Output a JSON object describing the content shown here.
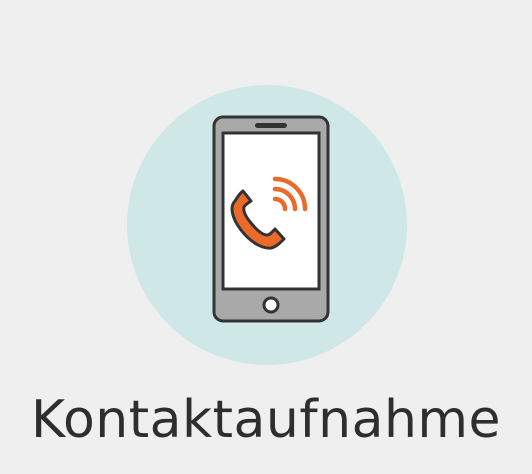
{
  "tile": {
    "label": "Kontaktaufnahme",
    "icon": "phone-call-icon"
  },
  "colors": {
    "background": "#efefef",
    "circle": "#cfe8e7",
    "phone_body": "#a9a9a9",
    "phone_outline": "#333333",
    "screen": "#ffffff",
    "accent": "#ea6a2a",
    "text": "#2e2e2e"
  }
}
